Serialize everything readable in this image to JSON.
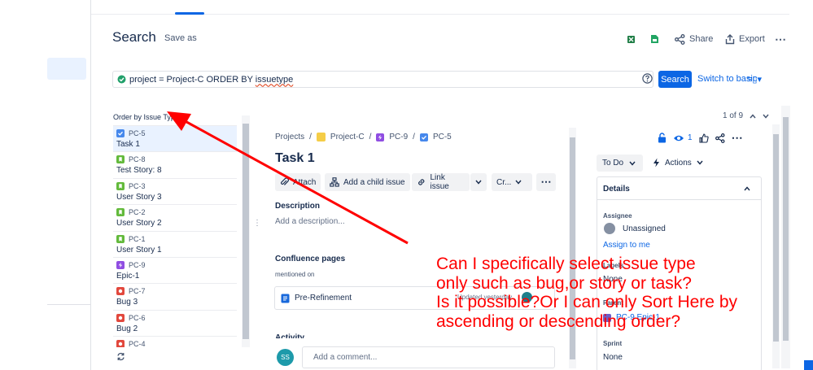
{
  "header": {
    "title": "Search",
    "save_as": "Save as",
    "share": "Share",
    "export": "Export"
  },
  "jql": {
    "query_prefix": "project = Project-C ORDER BY ",
    "query_underlined": "issuetype",
    "search_button": "Search",
    "switch_basic": "Switch to basic",
    "view_toggle": "≡▯▾"
  },
  "list": {
    "order_by": "Order by Issue Type",
    "items": [
      {
        "key": "PC-5",
        "summary": "Task 1",
        "type": "task",
        "color": "#4688ec"
      },
      {
        "key": "PC-8",
        "summary": "Test Story: 8",
        "type": "story",
        "color": "#63ba3c"
      },
      {
        "key": "PC-3",
        "summary": "User Story 3",
        "type": "story",
        "color": "#63ba3c"
      },
      {
        "key": "PC-2",
        "summary": "User Story 2",
        "type": "story",
        "color": "#63ba3c"
      },
      {
        "key": "PC-1",
        "summary": "User Story 1",
        "type": "story",
        "color": "#63ba3c"
      },
      {
        "key": "PC-9",
        "summary": "Epic-1",
        "type": "epic",
        "color": "#904ee2"
      },
      {
        "key": "PC-7",
        "summary": "Bug 3",
        "type": "bug",
        "color": "#e2483d"
      },
      {
        "key": "PC-6",
        "summary": "Bug 2",
        "type": "bug",
        "color": "#e2483d"
      },
      {
        "key": "PC-4",
        "summary": "",
        "type": "bug",
        "color": "#e2483d"
      }
    ]
  },
  "detail": {
    "breadcrumb": [
      "Projects",
      "Project-C",
      "PC-9",
      "PC-5"
    ],
    "title": "Task 1",
    "actions": [
      "Attach",
      "Add a child issue",
      "Link issue",
      "Cr..."
    ],
    "description_label": "Description",
    "description_placeholder": "Add a description...",
    "confluence_label": "Confluence pages",
    "mentioned_on": "mentioned on",
    "page_title": "Pre-Refinement",
    "updated": "Updated yesterday",
    "activity": "Activity",
    "comment_placeholder": "Add a comment...",
    "comment_avatar": "SS"
  },
  "side": {
    "pager": "1 of 9",
    "watchers": "1",
    "status": "To Do",
    "actions": "Actions",
    "details": "Details",
    "assignee_label": "Assignee",
    "assignee_value": "Unassigned",
    "assign_to_me": "Assign to me",
    "labels_label": "Labels",
    "labels_value": "None",
    "parent_label": "Parent",
    "parent_value": "PC-9 Epic-1",
    "sprint_label": "Sprint",
    "sprint_value": "None"
  },
  "annotation": {
    "lines": [
      "Can I specifically select issue type",
      "only such as bug,or story or task?",
      "Is it possible?Or I can only Sort Here by",
      "ascending or descending order?"
    ],
    "color": "#ff0000"
  }
}
